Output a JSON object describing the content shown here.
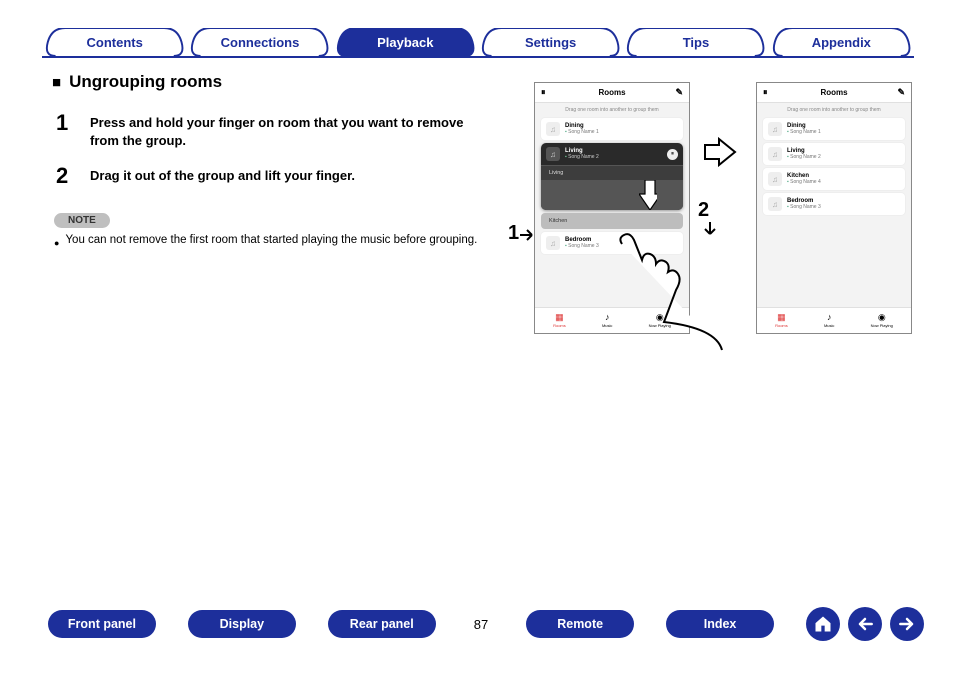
{
  "tabs": {
    "items": [
      {
        "label": "Contents",
        "active": false
      },
      {
        "label": "Connections",
        "active": false
      },
      {
        "label": "Playback",
        "active": true
      },
      {
        "label": "Settings",
        "active": false
      },
      {
        "label": "Tips",
        "active": false
      },
      {
        "label": "Appendix",
        "active": false
      }
    ]
  },
  "section": {
    "title": "Ungrouping rooms",
    "steps": [
      {
        "num": "1",
        "text": "Press and hold your finger on room that you want to remove from the group."
      },
      {
        "num": "2",
        "text": "Drag it out of the group and lift your finger."
      }
    ],
    "note_label": "NOTE",
    "note_text": "You can not remove the first room that started playing the music before grouping."
  },
  "phone": {
    "header_title": "Rooms",
    "hint": "Drag one room into another to group them",
    "footer": {
      "rooms": "Rooms",
      "music": "Music",
      "now": "Now Playing"
    },
    "left": {
      "rooms": [
        {
          "name": "Dining",
          "song": "Song Name 1"
        }
      ],
      "group": {
        "name": "Living",
        "song": "Song Name 2",
        "sub": "Living"
      },
      "drag": "Kitchen",
      "bottom_room": {
        "name": "Bedroom",
        "song": "Song Name 3"
      }
    },
    "right": {
      "rooms": [
        {
          "name": "Dining",
          "song": "Song Name 1"
        },
        {
          "name": "Living",
          "song": "Song Name 2"
        },
        {
          "name": "Kitchen",
          "song": "Song Name 4"
        },
        {
          "name": "Bedroom",
          "song": "Song Name 3"
        }
      ]
    }
  },
  "markers": {
    "one": "1",
    "two": "2"
  },
  "bottom": {
    "buttons": [
      "Front panel",
      "Display",
      "Rear panel",
      "Remote",
      "Index"
    ],
    "page": "87"
  },
  "colors": {
    "accent": "#1d2f9b"
  }
}
